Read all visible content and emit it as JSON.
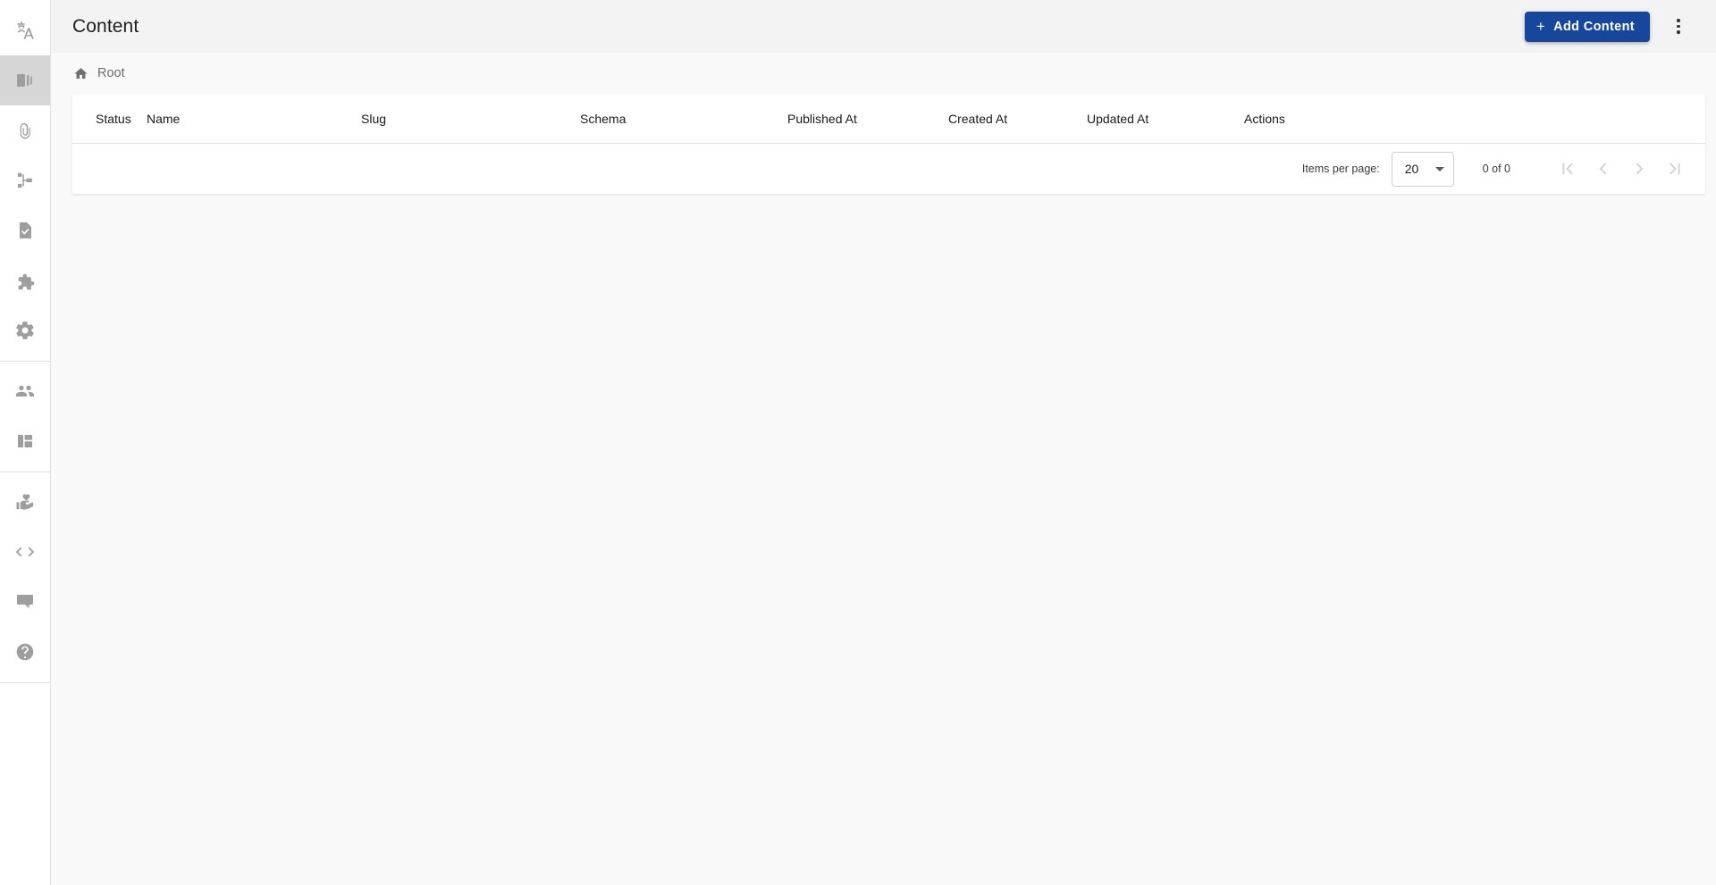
{
  "sidebar": {
    "groups": [
      {
        "items": [
          {
            "id": "translate",
            "icon": "translate-icon",
            "active": false
          },
          {
            "id": "content",
            "icon": "content-pages-icon",
            "active": true
          },
          {
            "id": "assets",
            "icon": "paperclip-icon",
            "active": false
          },
          {
            "id": "structure",
            "icon": "account-tree-icon",
            "active": false
          },
          {
            "id": "forms",
            "icon": "document-check-icon",
            "active": false
          },
          {
            "id": "extensions",
            "icon": "puzzle-piece-icon",
            "active": false
          },
          {
            "id": "settings",
            "icon": "gear-icon",
            "active": false
          }
        ]
      },
      {
        "items": [
          {
            "id": "users",
            "icon": "people-icon",
            "active": false
          },
          {
            "id": "dashboard",
            "icon": "layout-icon",
            "active": false
          }
        ]
      },
      {
        "items": [
          {
            "id": "support",
            "icon": "volunteer-hand-heart-icon",
            "active": false
          },
          {
            "id": "developer",
            "icon": "code-brackets-icon",
            "active": false
          },
          {
            "id": "feedback",
            "icon": "chat-bubble-icon",
            "active": false
          },
          {
            "id": "help",
            "icon": "help-circle-icon",
            "active": false
          }
        ]
      }
    ]
  },
  "header": {
    "title": "Content",
    "add_button_label": "Add Content",
    "add_button_plus": "+",
    "add_button_color": "#16479d",
    "overflow_menu_icon": "more-vertical-icon"
  },
  "breadcrumb": {
    "home_icon": "home-icon",
    "items": [
      {
        "label": "Root"
      }
    ]
  },
  "table": {
    "columns": [
      {
        "key": "status",
        "label": "Status"
      },
      {
        "key": "name",
        "label": "Name"
      },
      {
        "key": "slug",
        "label": "Slug"
      },
      {
        "key": "schema",
        "label": "Schema"
      },
      {
        "key": "published",
        "label": "Published At"
      },
      {
        "key": "created",
        "label": "Created At"
      },
      {
        "key": "updated",
        "label": "Updated At"
      },
      {
        "key": "actions",
        "label": "Actions"
      }
    ],
    "rows": []
  },
  "paginator": {
    "items_per_page_label": "Items per page:",
    "items_per_page_value": "20",
    "items_per_page_options": [
      "20"
    ],
    "range_label": "0 of 0",
    "first_page_icon": "first-page-icon",
    "prev_page_icon": "chevron-left-icon",
    "next_page_icon": "chevron-right-icon",
    "last_page_icon": "last-page-icon"
  }
}
